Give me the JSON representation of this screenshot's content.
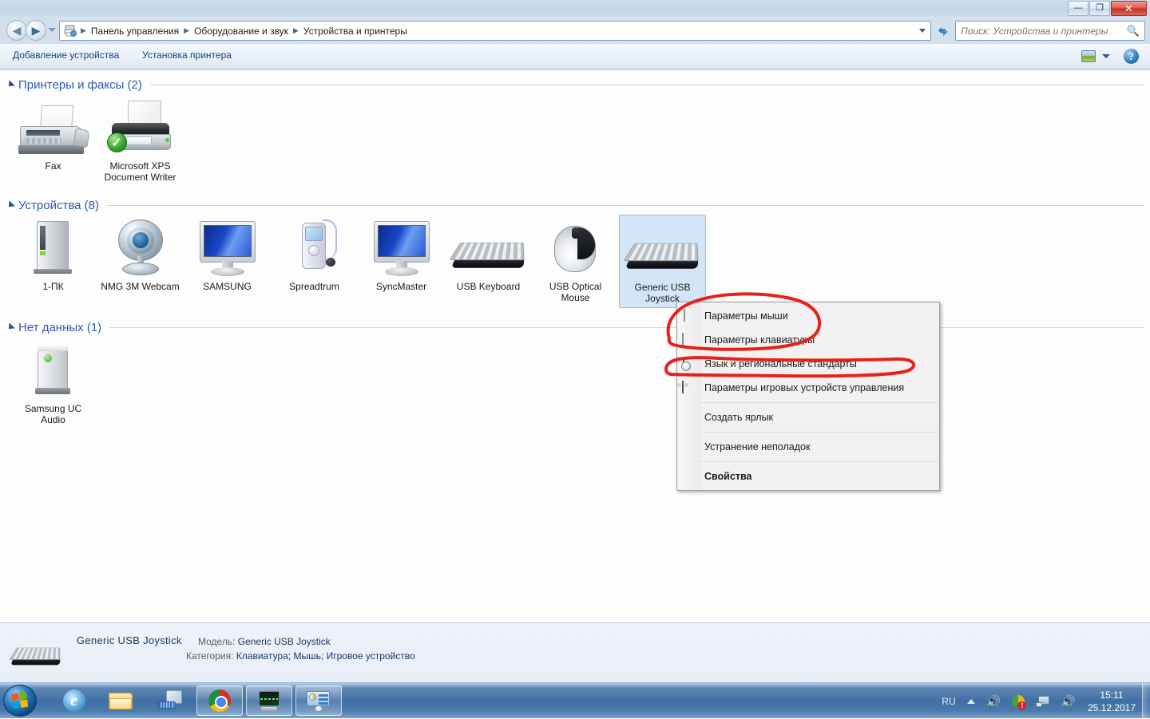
{
  "window": {
    "controls": {
      "minimize": "—",
      "maximize": "❐",
      "close": "✕"
    }
  },
  "address_bar": {
    "icon": "devices-printers-icon",
    "breadcrumbs": [
      "Панель управления",
      "Оборудование и звук",
      "Устройства и принтеры"
    ],
    "separator": "▶",
    "history_dropdown": "chevron-down-icon",
    "refresh": "↻"
  },
  "search": {
    "placeholder": "Поиск: Устройства и принтеры",
    "value": "",
    "icon": "search-icon"
  },
  "command_bar": {
    "add_device": "Добавление устройства",
    "add_printer": "Установка принтера",
    "view_icon": "view-layout-icon",
    "view_caret": "chevron-down-icon",
    "help_icon": "?"
  },
  "sections": [
    {
      "id": "printers",
      "title": "Принтеры и факсы (2)",
      "items": [
        {
          "label": "Fax",
          "icon": "fax-icon",
          "selected": false
        },
        {
          "label": "Microsoft XPS Document Writer",
          "icon": "printer-icon",
          "selected": false,
          "badge": "default-check"
        }
      ]
    },
    {
      "id": "devices",
      "title": "Устройства (8)",
      "items": [
        {
          "label": "1-ПК",
          "icon": "computer-tower-icon",
          "selected": false
        },
        {
          "label": "NMG 3M Webcam",
          "icon": "webcam-icon",
          "selected": false
        },
        {
          "label": "SAMSUNG",
          "icon": "monitor-icon",
          "selected": false
        },
        {
          "label": "Spreadtrum",
          "icon": "phone-icon",
          "selected": false
        },
        {
          "label": "SyncMaster",
          "icon": "monitor-icon",
          "selected": false
        },
        {
          "label": "USB Keyboard",
          "icon": "keyboard-icon",
          "selected": false
        },
        {
          "label": "USB Optical Mouse",
          "icon": "mouse-icon",
          "selected": false
        },
        {
          "label": "Generic USB Joystick",
          "icon": "keyboard-icon",
          "selected": true
        }
      ]
    },
    {
      "id": "nodata",
      "title": "Нет данных (1)",
      "items": [
        {
          "label": "Samsung UC Audio",
          "icon": "speaker-icon",
          "selected": false
        }
      ]
    }
  ],
  "context_menu": {
    "items": [
      {
        "label": "Параметры мыши",
        "icon": "mouse-icon",
        "bold": false,
        "separator_after": false
      },
      {
        "label": "Параметры клавиатуры",
        "icon": "keyboard-icon",
        "bold": false,
        "separator_after": false
      },
      {
        "label": "Язык и региональные стандарты",
        "icon": "globe-clock-icon",
        "bold": false,
        "separator_after": false
      },
      {
        "label": "Параметры игровых устройств управления",
        "icon": "gamepad-icon",
        "bold": false,
        "separator_after": true
      },
      {
        "label": "Создать ярлык",
        "icon": "",
        "bold": false,
        "separator_after": true
      },
      {
        "label": "Устранение неполадок",
        "icon": "",
        "bold": false,
        "separator_after": true
      },
      {
        "label": "Свойства",
        "icon": "",
        "bold": true,
        "separator_after": false
      }
    ]
  },
  "annotation": {
    "color": "#e8201a",
    "shapes": [
      "ellipse-around-mouse-and-keyboard-items",
      "ellipse-around-game-controller-item"
    ]
  },
  "details_pane": {
    "icon": "keyboard-icon",
    "title": "Generic  USB  Joystick",
    "model_key": "Модель:",
    "model_value": "Generic  USB  Joystick",
    "category_key": "Категория:",
    "category_value": "Клавиатура; Мышь; Игровое устройство"
  },
  "taskbar": {
    "start": "start-orb",
    "buttons": [
      {
        "name": "internet-explorer",
        "icon": "ie-icon",
        "active": false
      },
      {
        "name": "explorer",
        "icon": "folder-icon",
        "active": false
      },
      {
        "name": "keyboard-monitor-app",
        "icon": "keyboard-monitor-icon",
        "active": false
      },
      {
        "name": "google-chrome",
        "icon": "chrome-icon",
        "active": true
      },
      {
        "name": "performance-monitor",
        "icon": "performance-icon",
        "active": true
      },
      {
        "name": "devices-and-printers",
        "icon": "devices-printers-icon",
        "active": true
      }
    ],
    "tray": {
      "language": "RU",
      "expand": "show-hidden-icons-caret",
      "icons": [
        "volume-icon",
        "action-center-icon",
        "network-icon",
        "speaker-icon"
      ],
      "time": "15:11",
      "date": "25.12.2017"
    }
  }
}
